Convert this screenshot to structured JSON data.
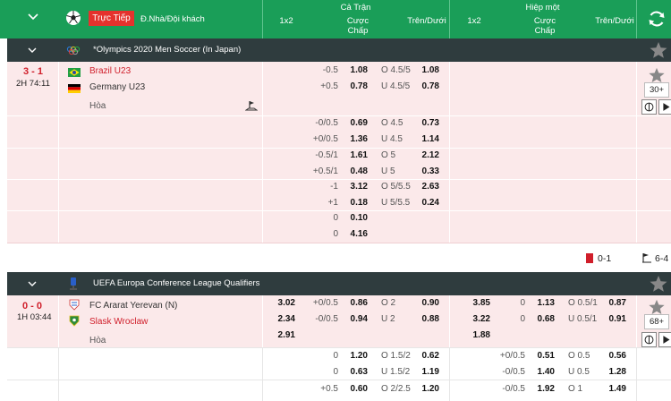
{
  "header": {
    "live_tab": "Trực Tiếp",
    "side_tab": "Đ.Nhà/Đội khách",
    "full_match": "Cả Trận",
    "first_half": "Hiệp một",
    "col_1x2": "1x2",
    "col_handicap_1": "Cược",
    "col_handicap_2": "Chấp",
    "col_ou": "Trên/Dưới"
  },
  "leagues": [
    {
      "name": "*Olympics 2020 Men Soccer (In Japan)",
      "match": {
        "score": "3 - 1",
        "clock": "2H 74:11",
        "home": "Brazil U23",
        "away": "Germany U23",
        "draw_label": "Hòa",
        "more_count": "30+",
        "red_cards": "0-1",
        "corners": "6-4",
        "ft_rows": [
          {
            "hdp_home": "-0.5",
            "hdp_away": "+0.5",
            "odds_home": "1.08",
            "odds_away": "0.78",
            "ou_over": "O 4.5/5",
            "ou_under": "U 4.5/5",
            "ou_over_odds": "1.08",
            "ou_under_odds": "0.78"
          },
          {
            "hdp_home": "-0/0.5",
            "hdp_away": "+0/0.5",
            "odds_home": "0.69",
            "odds_away": "1.36",
            "ou_over": "O 4.5",
            "ou_under": "U 4.5",
            "ou_over_odds": "0.73",
            "ou_under_odds": "1.14"
          },
          {
            "hdp_home": "-0.5/1",
            "hdp_away": "+0.5/1",
            "odds_home": "1.61",
            "odds_away": "0.48",
            "ou_over": "O 5",
            "ou_under": "U 5",
            "ou_over_odds": "2.12",
            "ou_under_odds": "0.33"
          },
          {
            "hdp_home": "-1",
            "hdp_away": "+1",
            "odds_home": "3.12",
            "odds_away": "0.18",
            "ou_over": "O 5/5.5",
            "ou_under": "U 5/5.5",
            "ou_over_odds": "2.63",
            "ou_under_odds": "0.24"
          },
          {
            "hdp_home": "0",
            "hdp_away": "0",
            "odds_home": "0.10",
            "odds_away": "4.16",
            "ou_over": "",
            "ou_under": "",
            "ou_over_odds": "",
            "ou_under_odds": ""
          }
        ]
      }
    },
    {
      "name": "UEFA Europa Conference League Qualifiers",
      "match": {
        "score": "0 - 0",
        "clock": "1H 03:44",
        "home": "FC Ararat Yerevan (N)",
        "away": "Slask Wroclaw",
        "draw_label": "Hòa",
        "more_count": "68+",
        "ft_1x2": [
          "3.02",
          "2.34",
          "2.91"
        ],
        "ht_1x2": [
          "3.85",
          "3.22",
          "1.88"
        ],
        "ft_rows": [
          {
            "hdp_home": "+0/0.5",
            "hdp_away": "-0/0.5",
            "odds_home": "0.86",
            "odds_away": "0.94",
            "ou_over": "O 2",
            "ou_under": "U 2",
            "ou_over_odds": "0.90",
            "ou_under_odds": "0.88"
          },
          {
            "hdp_home": "0",
            "hdp_away": "0",
            "odds_home": "1.20",
            "odds_away": "0.63",
            "ou_over": "O 1.5/2",
            "ou_under": "U 1.5/2",
            "ou_over_odds": "0.62",
            "ou_under_odds": "1.19"
          },
          {
            "hdp_home": "+0.5",
            "hdp_away": "",
            "odds_home": "0.60",
            "odds_away": "",
            "ou_over": "O 2/2.5",
            "ou_under": "",
            "ou_over_odds": "1.20",
            "ou_under_odds": ""
          }
        ],
        "ht_rows": [
          {
            "hdp_home": "0",
            "hdp_away": "0",
            "odds_home": "1.13",
            "odds_away": "0.68",
            "ou_over": "O 0.5/1",
            "ou_under": "U 0.5/1",
            "ou_over_odds": "0.87",
            "ou_under_odds": "0.91"
          },
          {
            "hdp_home": "+0/0.5",
            "hdp_away": "-0/0.5",
            "odds_home": "0.51",
            "odds_away": "1.40",
            "ou_over": "O 0.5",
            "ou_under": "U 0.5",
            "ou_over_odds": "0.56",
            "ou_under_odds": "1.28"
          },
          {
            "hdp_home": "-0/0.5",
            "hdp_away": "",
            "odds_home": "1.92",
            "odds_away": "",
            "ou_over": "O 1",
            "ou_under": "",
            "ou_over_odds": "1.49",
            "ou_under_odds": ""
          }
        ]
      }
    }
  ],
  "colors": {
    "header_green": "#1a9e58",
    "live_red": "#e5322d",
    "league_bar": "#2f3c3e",
    "row_pink": "#fbe9ea",
    "team_red": "#d01e2a"
  },
  "icons": [
    "chevron-down-icon",
    "soccer-ball-icon",
    "refresh-icon",
    "star-icon",
    "olympic-rings-icon",
    "uefa-icon",
    "pitch-icon",
    "play-icon",
    "corner-flag-icon",
    "red-card-icon",
    "brazil-flag-icon",
    "germany-flag-icon",
    "ararat-crest-icon",
    "slask-crest-icon"
  ]
}
